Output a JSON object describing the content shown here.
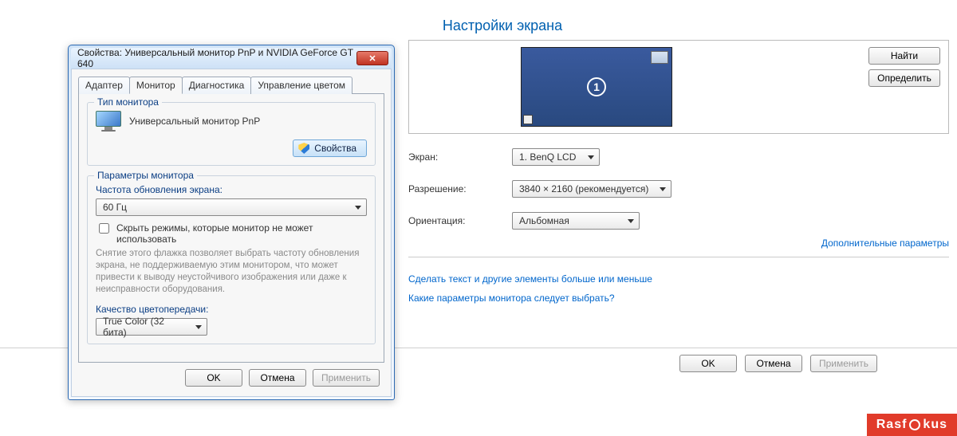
{
  "page_title": "Настройки экрана",
  "preview": {
    "monitor_number": "1"
  },
  "side_buttons": {
    "find": "Найти",
    "identify": "Определить"
  },
  "form": {
    "screen_label": "Экран:",
    "screen_value": "1. BenQ LCD",
    "res_label": "Разрешение:",
    "res_value": "3840 × 2160 (рекомендуется)",
    "orient_label": "Ориентация:",
    "orient_value": "Альбомная"
  },
  "links": {
    "extra": "Дополнительные параметры",
    "textsize": "Сделать текст и другие элементы больше или меньше",
    "which": "Какие параметры монитора следует выбрать?"
  },
  "bottom": {
    "ok": "OK",
    "cancel": "Отмена",
    "apply": "Применить"
  },
  "dialog": {
    "title": "Свойства: Универсальный монитор PnP и NVIDIA GeForce GT 640",
    "tabs": {
      "adapter": "Адаптер",
      "monitor": "Монитор",
      "diag": "Диагностика",
      "color": "Управление цветом"
    },
    "type_group": {
      "legend": "Тип монитора",
      "name": "Универсальный монитор PnP",
      "props_btn": "Свойства"
    },
    "params_group": {
      "legend": "Параметры монитора",
      "refresh_label": "Частота обновления экрана:",
      "refresh_value": "60 Гц",
      "hide_modes": "Скрыть режимы, которые монитор не может использовать",
      "hint": "Снятие этого флажка позволяет выбрать частоту обновления экрана, не поддерживаемую этим монитором, что может привести к выводу неустойчивого изображения или даже к неисправности оборудования.",
      "cq_label": "Качество цветопередачи:",
      "cq_value": "True Color (32 бита)"
    },
    "buttons": {
      "ok": "OK",
      "cancel": "Отмена",
      "apply": "Применить"
    }
  },
  "watermark": {
    "a": "Rasf",
    "b": "kus"
  }
}
